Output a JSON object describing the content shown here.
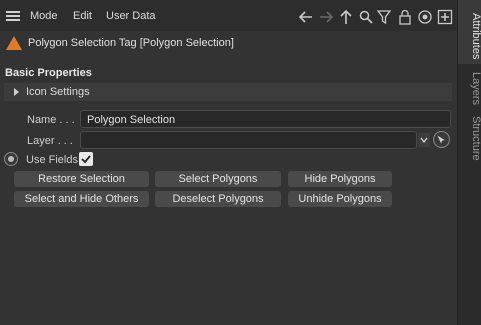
{
  "menubar": {
    "items": [
      "Mode",
      "Edit",
      "User Data"
    ],
    "icons": [
      "arrow-left-icon",
      "arrow-right-icon",
      "arrow-up-icon",
      "search-icon",
      "filter-icon",
      "lock-icon",
      "target-icon",
      "add-icon"
    ]
  },
  "header": {
    "title": "Polygon Selection Tag [Polygon Selection]"
  },
  "section": {
    "title": "Basic Properties",
    "group": "Icon Settings"
  },
  "fields": {
    "name_label": "Name . . .",
    "name_value": "Polygon Selection",
    "layer_label": "Layer  . . .",
    "layer_value": "",
    "use_fields_label": "Use Fields"
  },
  "buttons": {
    "row1": [
      "Restore Selection",
      "Select Polygons",
      "Hide Polygons"
    ],
    "row2": [
      "Select and Hide Others",
      "Deselect Polygons",
      "Unhide Polygons"
    ]
  },
  "sidetabs": [
    "Attributes",
    "Layers",
    "Structure"
  ],
  "colors": {
    "tag_icon": "#e07b2a",
    "background": "#333333"
  }
}
